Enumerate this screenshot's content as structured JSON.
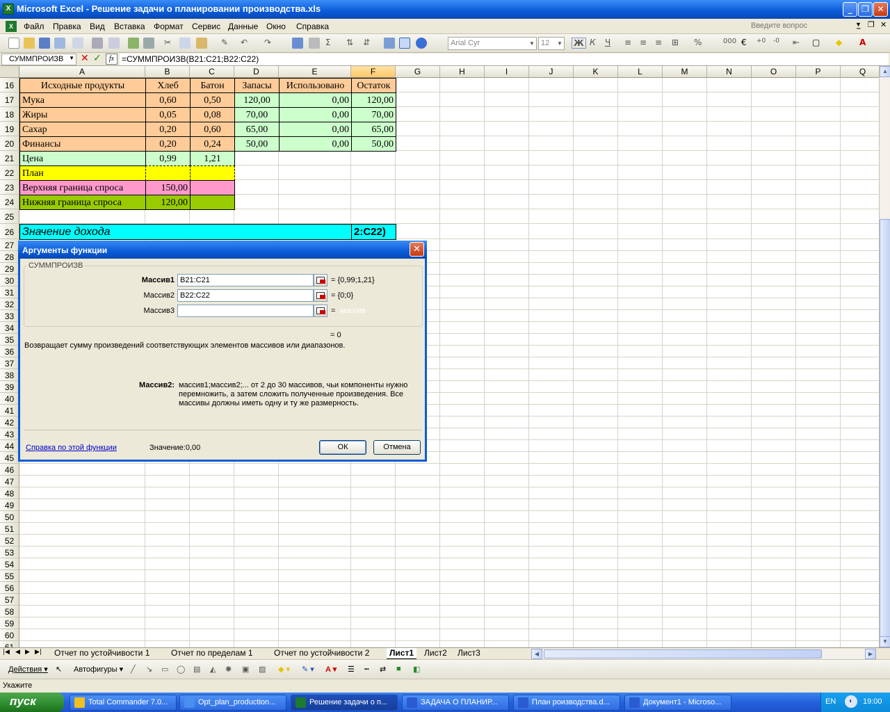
{
  "window": {
    "title": "Microsoft Excel - Решение задачи о планировании производства.xls",
    "app_icon": "excel-icon"
  },
  "menu": {
    "items": [
      "Файл",
      "Правка",
      "Вид",
      "Вставка",
      "Формат",
      "Сервис",
      "Данные",
      "Окно",
      "Справка"
    ],
    "ask_placeholder": "Введите вопрос"
  },
  "toolbar": {
    "font_name": "Arial Cyr",
    "font_size": "12"
  },
  "formula_bar": {
    "name_box": "СУММПРОИЗВ",
    "formula": "=СУММПРОИЗВ(B21:C21;B22:C22)"
  },
  "columns": [
    "A",
    "B",
    "C",
    "D",
    "E",
    "F",
    "G",
    "H",
    "I",
    "J",
    "K",
    "L",
    "M",
    "N",
    "O",
    "P",
    "Q"
  ],
  "selected_column": "F",
  "rows": [
    "16",
    "17",
    "18",
    "19",
    "20",
    "21",
    "22",
    "23",
    "24",
    "25",
    "26",
    "27",
    "28",
    "29",
    "30",
    "31",
    "32",
    "33",
    "34",
    "35",
    "36",
    "37",
    "38",
    "39",
    "40",
    "41",
    "42",
    "43",
    "44",
    "45",
    "46",
    "47",
    "48",
    "49",
    "50",
    "51",
    "52",
    "53",
    "54",
    "55",
    "56",
    "57",
    "58",
    "59",
    "60",
    "61"
  ],
  "sheet": {
    "header": [
      "Исходные продукты",
      "Хлеб",
      "Батон",
      "Запасы",
      "Использовано",
      "Остаток"
    ],
    "resources": [
      {
        "name": "Мука",
        "bread": "0,60",
        "loaf": "0,50",
        "stock": "120,00",
        "used": "0,00",
        "rest": "120,00"
      },
      {
        "name": "Жиры",
        "bread": "0,05",
        "loaf": "0,08",
        "stock": "70,00",
        "used": "0,00",
        "rest": "70,00"
      },
      {
        "name": "Сахар",
        "bread": "0,20",
        "loaf": "0,60",
        "stock": "65,00",
        "used": "0,00",
        "rest": "65,00"
      },
      {
        "name": "Финансы",
        "bread": "0,20",
        "loaf": "0,24",
        "stock": "50,00",
        "used": "0,00",
        "rest": "50,00"
      }
    ],
    "price": {
      "label": "Цена",
      "bread": "0,99",
      "loaf": "1,21"
    },
    "plan": {
      "label": "План"
    },
    "upper": {
      "label": "Верхняя граница спроса",
      "bread": "150,00"
    },
    "lower": {
      "label": "Нижняя граница спроса",
      "bread": "120,00"
    },
    "income": {
      "label": "Значение дохода",
      "formula_tail": "2:C22)"
    },
    "colors": {
      "header": "#ffcc99",
      "green": "#ccffcc",
      "yellow": "#ffff00",
      "pink": "#ff99cc",
      "olive": "#99cc00",
      "cyan": "#00ffff"
    }
  },
  "dialog": {
    "title": "Аргументы функции",
    "function_name": "СУММПРОИЗВ",
    "args": [
      {
        "label": "Массив1",
        "value": "B21:C21",
        "result": "= {0,99;1,21}",
        "bold": true
      },
      {
        "label": "Массив2",
        "value": "B22:C22",
        "result": "= {0;0}",
        "bold": false
      },
      {
        "label": "Массив3",
        "value": "",
        "result": "= ",
        "faded": "массив",
        "bold": false
      }
    ],
    "total": "= 0",
    "description": "Возвращает сумму произведений соответствующих элементов массивов или диапазонов.",
    "arg_help_label": "Массив2:",
    "arg_help_text": "массив1;массив2;... от 2 до 30 массивов, чьи компоненты нужно перемножить, а затем сложить полученные произведения. Все массивы должны иметь одну и ту же размерность.",
    "help_link": "Справка по этой функции",
    "value_label": "Значение:",
    "value": "0,00",
    "ok": "ОК",
    "cancel": "Отмена"
  },
  "sheet_tabs": [
    "Отчет по устойчивости 1",
    "Отчет по пределам 1",
    "Отчет по устойчивости 2",
    "Лист1",
    "Лист2",
    "Лист3"
  ],
  "active_tab": "Лист1",
  "drawing": {
    "actions": "Действия",
    "autoshapes": "Автофигуры"
  },
  "status": "Укажите",
  "taskbar": {
    "start": "пуск",
    "tasks": [
      "Total Commander 7.0...",
      "Opt_plan_production...",
      "Решение задачи о п...",
      "ЗАДАЧА О ПЛАНИР...",
      "План роизводства.d...",
      "Документ1 - Microso..."
    ],
    "active_task": "Решение задачи о п...",
    "lang": "EN",
    "clock": "19:00"
  }
}
